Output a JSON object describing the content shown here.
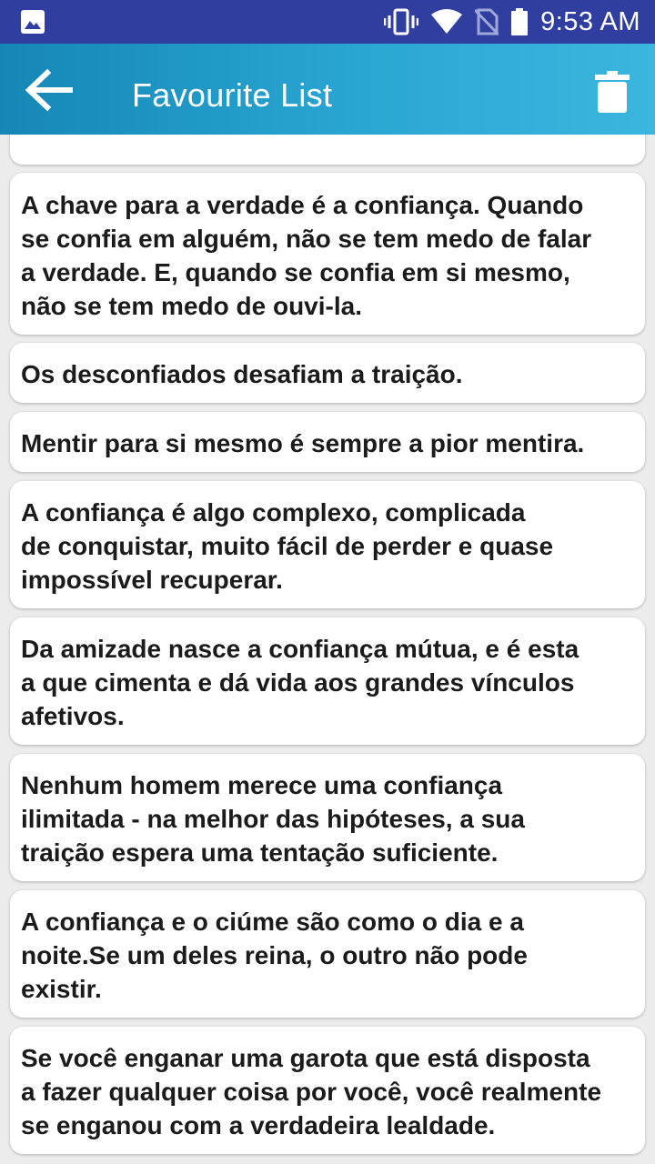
{
  "status_bar": {
    "time": "9:53 AM",
    "icons": [
      "image-icon",
      "vibrate-icon",
      "wifi-icon",
      "no-sim-icon",
      "battery-icon"
    ]
  },
  "app_bar": {
    "title": "Favourite List",
    "back_icon": "arrow-left-icon",
    "delete_icon": "trash-icon"
  },
  "quotes": [
    "",
    "A chave para a verdade é a confiança. Quando\nse confia em alguém, não se tem medo de falar\na verdade. E, quando se confia em si mesmo,\nnão se tem medo de ouvi-la.",
    "Os desconfiados desafiam a traição.",
    "Mentir para si mesmo é sempre a pior mentira.",
    "A confiança é algo complexo, complicada\nde conquistar, muito fácil de perder e quase\nimpossível recuperar.",
    "Da amizade nasce a confiança mútua, e é esta\na que cimenta e dá vida aos grandes vínculos\nafetivos.",
    "Nenhum homem merece uma confiança\nilimitada - na melhor das hipóteses, a sua\ntraição espera uma tentação suficiente.",
    "A confiança e o ciúme são como o dia e a\nnoite.Se um deles reina, o outro não pode\nexistir.",
    "Se você enganar uma garota que está disposta\na fazer qualquer coisa por você, você realmente\nse enganou com a verdadeira lealdade."
  ]
}
